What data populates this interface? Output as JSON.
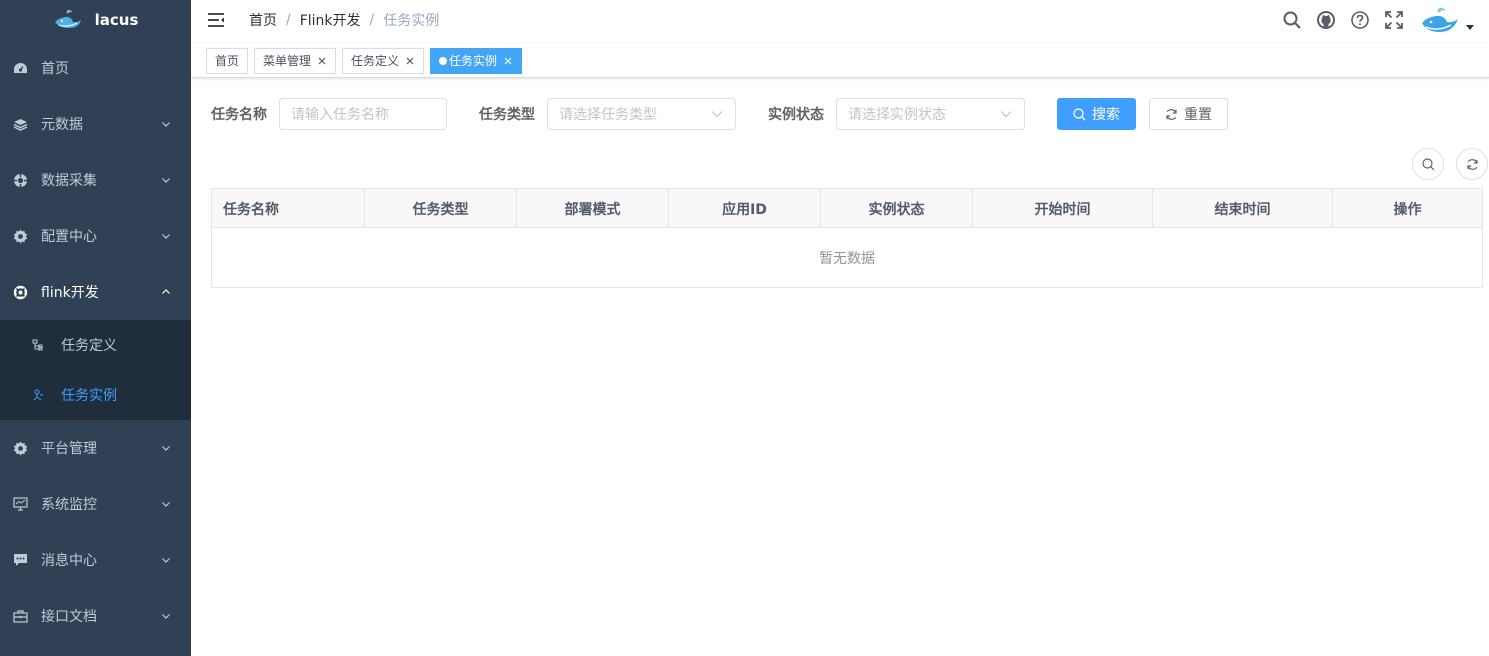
{
  "app": {
    "name": "lacus"
  },
  "sidebar": {
    "items": [
      {
        "label": "首页",
        "icon": "dashboard-icon",
        "has_children": false
      },
      {
        "label": "元数据",
        "icon": "layers-icon",
        "has_children": true
      },
      {
        "label": "数据采集",
        "icon": "gear-cog-icon",
        "has_children": true
      },
      {
        "label": "配置中心",
        "icon": "settings-icon",
        "has_children": true
      },
      {
        "label": "flink开发",
        "icon": "lifebuoy-icon",
        "has_children": true,
        "open": true,
        "children": [
          {
            "label": "任务定义",
            "icon": "tree-icon",
            "active": false
          },
          {
            "label": "任务实例",
            "icon": "instance-icon",
            "active": true
          }
        ]
      },
      {
        "label": "平台管理",
        "icon": "settings-icon",
        "has_children": true
      },
      {
        "label": "系统监控",
        "icon": "monitor-icon",
        "has_children": true
      },
      {
        "label": "消息中心",
        "icon": "message-icon",
        "has_children": true
      },
      {
        "label": "接口文档",
        "icon": "briefcase-icon",
        "has_children": true
      }
    ]
  },
  "breadcrumb": [
    "首页",
    "Flink开发",
    "任务实例"
  ],
  "navbar_icons": [
    "search-icon",
    "github-icon",
    "question-icon",
    "fullscreen-icon"
  ],
  "tags": [
    {
      "label": "首页",
      "closable": false,
      "active": false
    },
    {
      "label": "菜单管理",
      "closable": true,
      "active": false
    },
    {
      "label": "任务定义",
      "closable": true,
      "active": false
    },
    {
      "label": "任务实例",
      "closable": true,
      "active": true
    }
  ],
  "filters": {
    "task_name": {
      "label": "任务名称",
      "placeholder": "请输入任务名称"
    },
    "task_type": {
      "label": "任务类型",
      "placeholder": "请选择任务类型"
    },
    "instance_status": {
      "label": "实例状态",
      "placeholder": "请选择实例状态"
    },
    "search_label": "搜索",
    "reset_label": "重置"
  },
  "table": {
    "columns": [
      "任务名称",
      "任务类型",
      "部署模式",
      "应用ID",
      "实例状态",
      "开始时间",
      "结束时间",
      "操作"
    ],
    "empty_text": "暂无数据"
  },
  "colors": {
    "sidebar_bg": "#304156",
    "submenu_bg": "#1f2d3d",
    "accent": "#409eff",
    "active_tag": "#42a5f5"
  }
}
